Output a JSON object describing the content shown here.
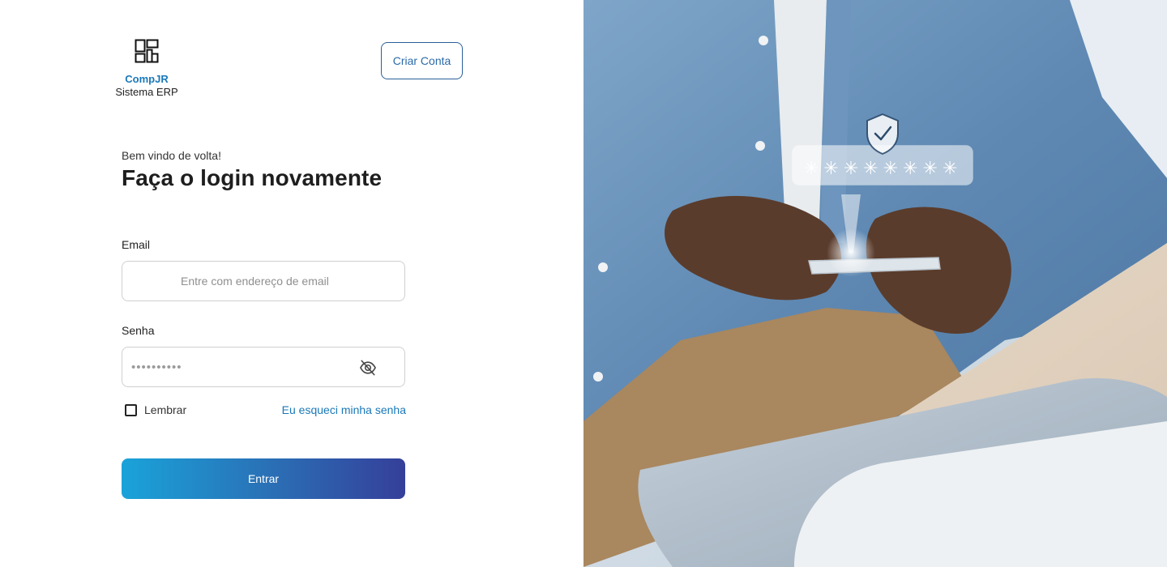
{
  "brand": {
    "name": "CompJR",
    "subtitle": "Sistema ERP",
    "icon": "layout-blocks-icon"
  },
  "header": {
    "create_account_label": "Criar Conta"
  },
  "login": {
    "welcome": "Bem vindo de volta!",
    "title": "Faça o login novamente",
    "email_label": "Email",
    "email_placeholder": "Entre com endereço de email",
    "password_label": "Senha",
    "password_value": "••••••••••",
    "password_toggle_icon": "eye-off-icon",
    "remember_label": "Lembrar",
    "remember_checked": false,
    "forgot_label": "Eu esqueci minha senha",
    "submit_label": "Entrar"
  },
  "hero_image": {
    "description_icon": "security-photo",
    "password_mask": "✳✳✳✳✳✳✳✳",
    "shield_icon": "shield-check-icon"
  },
  "colors": {
    "accent": "#1a78b8",
    "button_start": "#1aa3d9",
    "button_end": "#353f9a",
    "border": "#cfcfcf"
  }
}
